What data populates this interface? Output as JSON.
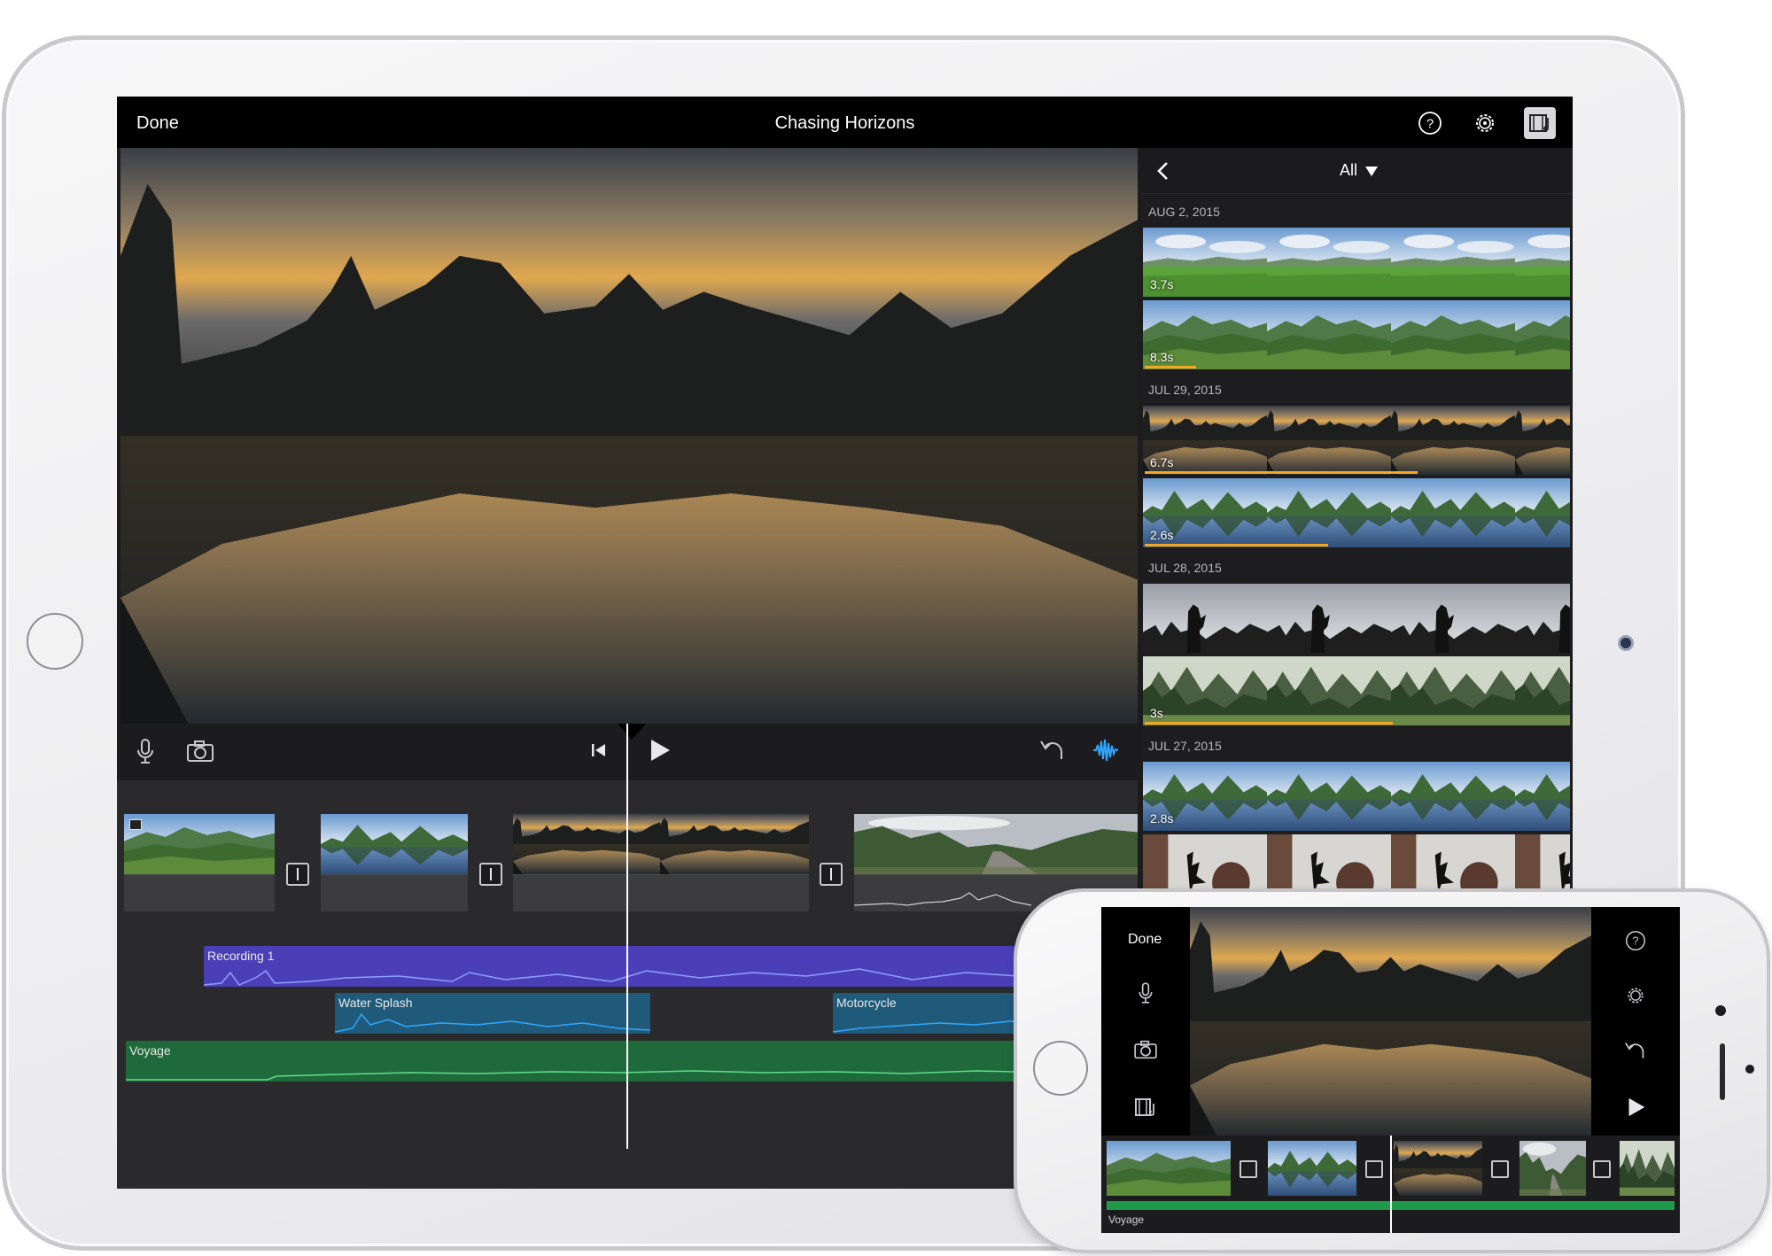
{
  "app": {
    "done_label": "Done",
    "project_title": "Chasing Horizons",
    "toolbar_icons": [
      "help-icon",
      "settings-gear-icon",
      "media-library-icon"
    ]
  },
  "browser": {
    "filter_label": "All",
    "groups": [
      {
        "date": "AUG 2, 2015",
        "clips": [
          {
            "duration": "3.7s",
            "used": 0
          },
          {
            "duration": "8.3s",
            "used": 0.12
          }
        ]
      },
      {
        "date": "JUL 29, 2015",
        "clips": [
          {
            "duration": "6.7s",
            "used": 0.64
          },
          {
            "duration": "2.6s",
            "used": 0.43
          }
        ]
      },
      {
        "date": "JUL 28, 2015",
        "clips": [
          {
            "duration": "",
            "used": 0
          },
          {
            "duration": "3s",
            "used": 0.58
          }
        ]
      },
      {
        "date": "JUL 27, 2015",
        "clips": [
          {
            "duration": "2.8s",
            "used": 0
          },
          {
            "duration": "",
            "used": 0
          }
        ]
      }
    ]
  },
  "controls": {
    "icons": [
      "microphone-icon",
      "camera-icon",
      "skip-to-start-icon",
      "play-icon",
      "undo-icon",
      "audio-waveform-icon"
    ]
  },
  "timeline": {
    "audio_tracks": [
      {
        "label": "Recording 1",
        "color": "#4b3fb8"
      },
      {
        "label": "Water Splash",
        "color": "#1f5a7a"
      },
      {
        "label": "Motorcycle",
        "color": "#1f5a7a"
      },
      {
        "label": "Voyage",
        "color": "#1e6a3a"
      }
    ]
  },
  "iphone": {
    "done_label": "Done",
    "left_icons": [
      "microphone-icon",
      "camera-icon",
      "media-library-icon"
    ],
    "right_icons": [
      "help-icon",
      "settings-gear-icon",
      "undo-icon",
      "play-icon"
    ],
    "audio_track_label": "Voyage"
  },
  "colors": {
    "accent_waveform": "#2fa8ff",
    "usage_bar": "#f5a623"
  }
}
